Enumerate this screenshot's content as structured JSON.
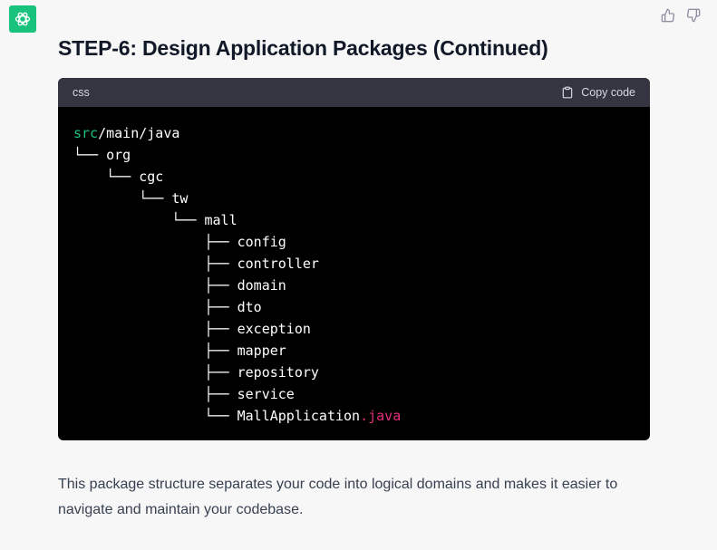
{
  "heading": "STEP-6: Design Application Packages (Continued)",
  "code_block": {
    "language": "css",
    "copy_label": "Copy code",
    "lines": [
      {
        "segments": [
          {
            "text": "src",
            "color": "green"
          },
          {
            "text": "/main/java"
          }
        ]
      },
      {
        "segments": [
          {
            "text": "└── org"
          }
        ]
      },
      {
        "segments": [
          {
            "text": "    └── cgc"
          }
        ]
      },
      {
        "segments": [
          {
            "text": "        └── tw"
          }
        ]
      },
      {
        "segments": [
          {
            "text": "            └── mall"
          }
        ]
      },
      {
        "segments": [
          {
            "text": "                ├── config"
          }
        ]
      },
      {
        "segments": [
          {
            "text": "                ├── controller"
          }
        ]
      },
      {
        "segments": [
          {
            "text": "                ├── domain"
          }
        ]
      },
      {
        "segments": [
          {
            "text": "                ├── dto"
          }
        ]
      },
      {
        "segments": [
          {
            "text": "                ├── exception"
          }
        ]
      },
      {
        "segments": [
          {
            "text": "                ├── mapper"
          }
        ]
      },
      {
        "segments": [
          {
            "text": "                ├── repository"
          }
        ]
      },
      {
        "segments": [
          {
            "text": "                ├── service"
          }
        ]
      },
      {
        "segments": [
          {
            "text": "                └── MallApplication"
          },
          {
            "text": ".java",
            "color": "pink"
          }
        ]
      }
    ]
  },
  "prose": "This package structure separates your code into logical domains and makes it easier to navigate and maintain your codebase.",
  "icons": {
    "avatar": "openai-logo-icon",
    "thumbs_up": "thumbs-up-icon",
    "thumbs_down": "thumbs-down-icon",
    "copy": "clipboard-icon"
  },
  "colors": {
    "avatar_bg": "#19c37d",
    "code_bg": "#000000",
    "code_header_bg": "#343541",
    "token_green": "#19c37d",
    "token_pink": "#df3079"
  }
}
